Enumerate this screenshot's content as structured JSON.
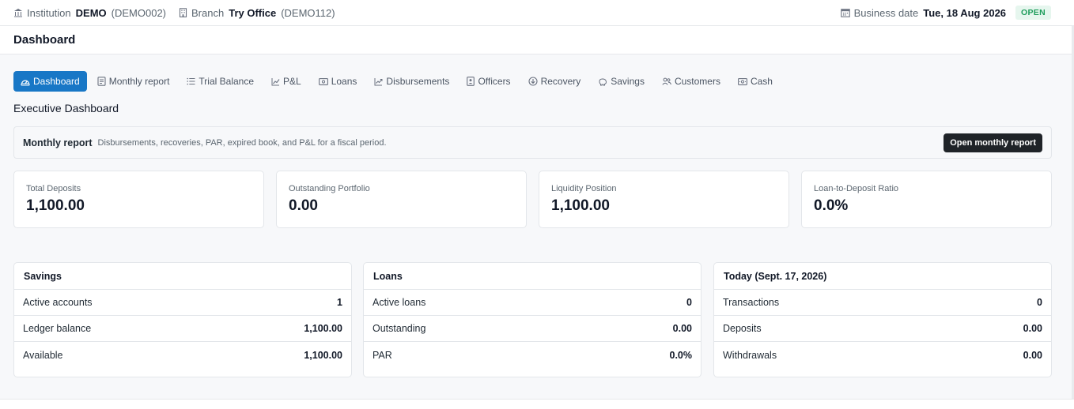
{
  "topbar": {
    "institution_label": "Institution",
    "institution_name": "DEMO",
    "institution_code": "(DEMO002)",
    "branch_label": "Branch",
    "branch_name": "Try Office",
    "branch_code": "(DEMO112)",
    "business_date_label": "Business date",
    "business_date": "Tue, 18 Aug 2026",
    "status": "OPEN"
  },
  "page_title": "Dashboard",
  "tabs": [
    {
      "label": "Dashboard",
      "icon": "gauge-icon",
      "active": true
    },
    {
      "label": "Monthly report",
      "icon": "report-icon"
    },
    {
      "label": "Trial Balance",
      "icon": "list-icon"
    },
    {
      "label": "P&L",
      "icon": "chart-line-icon"
    },
    {
      "label": "Loans",
      "icon": "banknote-icon"
    },
    {
      "label": "Disbursements",
      "icon": "trend-icon"
    },
    {
      "label": "Officers",
      "icon": "badge-icon"
    },
    {
      "label": "Recovery",
      "icon": "download-circle-icon"
    },
    {
      "label": "Savings",
      "icon": "piggy-icon"
    },
    {
      "label": "Customers",
      "icon": "users-icon"
    },
    {
      "label": "Cash",
      "icon": "cash-icon"
    }
  ],
  "section_title": "Executive Dashboard",
  "monthly": {
    "title": "Monthly report",
    "description": "Disbursements, recoveries, PAR, expired book, and P&L for a fiscal period.",
    "button": "Open monthly report"
  },
  "kpis": [
    {
      "label": "Total Deposits",
      "value": "1,100.00"
    },
    {
      "label": "Outstanding Portfolio",
      "value": "0.00"
    },
    {
      "label": "Liquidity Position",
      "value": "1,100.00"
    },
    {
      "label": "Loan-to-Deposit Ratio",
      "value": "0.0%"
    }
  ],
  "panels": {
    "savings": {
      "title": "Savings",
      "rows": [
        {
          "label": "Active accounts",
          "value": "1"
        },
        {
          "label": "Ledger balance",
          "value": "1,100.00"
        },
        {
          "label": "Available",
          "value": "1,100.00"
        }
      ]
    },
    "loans": {
      "title": "Loans",
      "rows": [
        {
          "label": "Active loans",
          "value": "0"
        },
        {
          "label": "Outstanding",
          "value": "0.00"
        },
        {
          "label": "PAR",
          "value": "0.0%"
        }
      ]
    },
    "today": {
      "title": "Today (Sept. 17, 2026)",
      "rows": [
        {
          "label": "Transactions",
          "value": "0"
        },
        {
          "label": "Deposits",
          "value": "0.00"
        },
        {
          "label": "Withdrawals",
          "value": "0.00"
        }
      ]
    }
  },
  "colors": {
    "accent": "#1877c6",
    "open_badge_bg": "#e6f6ee",
    "open_badge_text": "#1f9d5c",
    "dark_button": "#1f2328"
  }
}
